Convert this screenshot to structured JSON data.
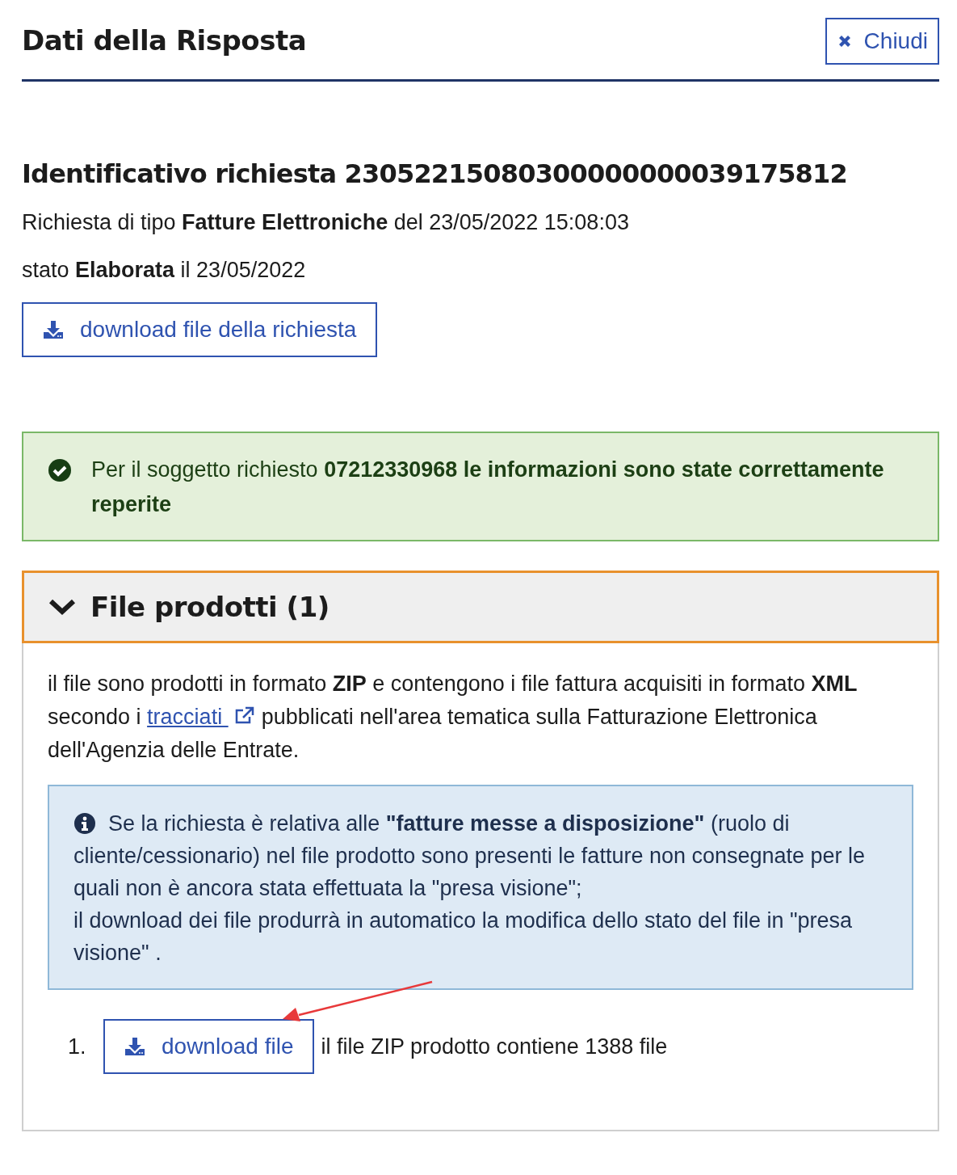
{
  "header": {
    "title": "Dati della Risposta",
    "close_button": "Chiudi"
  },
  "request": {
    "heading": "Identificativo richiesta 23052215080300000000039175812",
    "type_line": "Richiesta di tipo **Fatture Elettroniche** del 23/05/2022 15:08:03",
    "status_line": "stato **Elaborata** il 23/05/2022",
    "download_button": "download file della richiesta"
  },
  "alert": {
    "kind": "success",
    "text": "Per il soggetto richiesto **07212330968 le informazioni sono state correttamente reperite**"
  },
  "accordion": {
    "title": "File prodotti (1)",
    "expanded": true,
    "description": {
      "before": "il file sono prodotti in formato **ZIP** e contengono i file fattura acquisiti in formato **XML** secondo i",
      "link": "tracciati",
      "after": "pubblicati nell'area tematica sulla Fatturazione Elettronica dell'Agenzia delle Entrate."
    },
    "info": [
      "Se la richiesta è relativa alle **\"fatture messe a disposizione\"** (ruolo di cliente/cessionario) nel file prodotto sono presenti le fatture non consegnate per le quali non è ancora stata effettuata la \"presa visione\";",
      "il download dei file produrrà in automatico la modifica dello stato del file in \"presa visione\" ."
    ],
    "files": [
      {
        "number": "1.",
        "button": "download file",
        "note": "il file ZIP prodotto contiene 1388 file"
      }
    ]
  }
}
